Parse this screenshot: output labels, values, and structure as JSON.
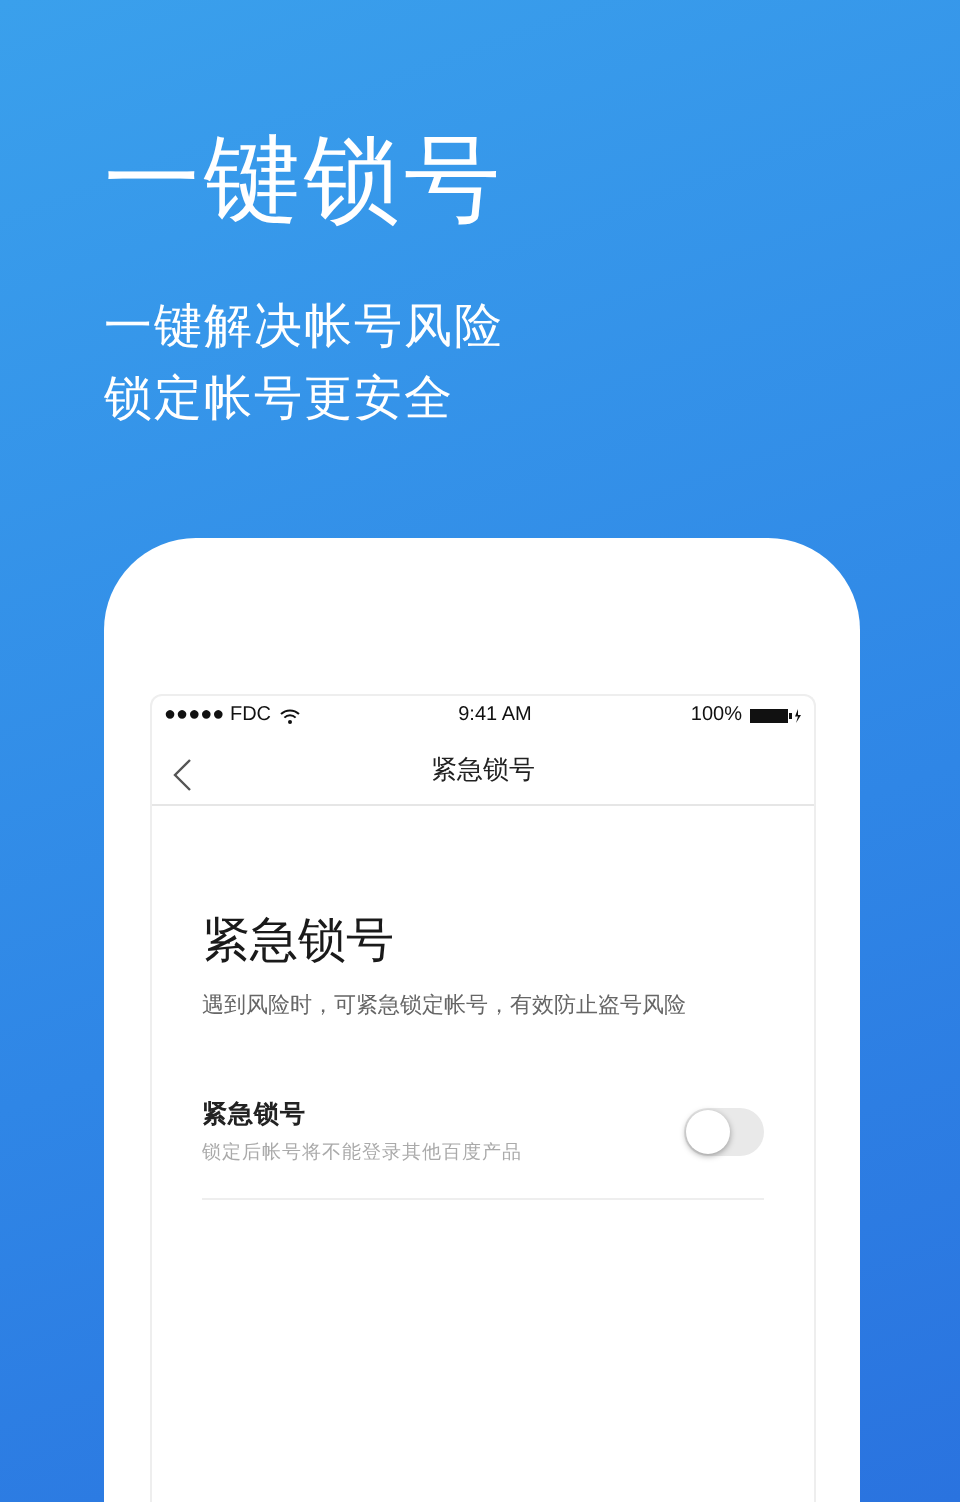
{
  "headline": "一键锁号",
  "taglines": [
    "一键解决帐号风险",
    "锁定帐号更安全"
  ],
  "status_bar": {
    "carrier": "●●●●● FDC",
    "time": "9:41 AM",
    "battery": "100%"
  },
  "nav": {
    "title": "紧急锁号"
  },
  "page": {
    "title": "紧急锁号",
    "description": "遇到风险时，可紧急锁定帐号，有效防止盗号风险"
  },
  "setting": {
    "label": "紧急锁号",
    "hint": "锁定后帐号将不能登录其他百度产品",
    "on": false
  }
}
